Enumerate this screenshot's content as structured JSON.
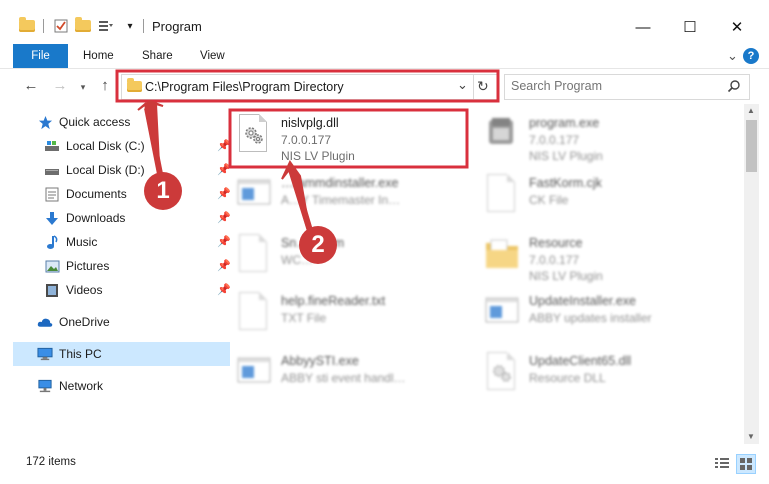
{
  "window": {
    "title": "Program",
    "min_glyph": "—",
    "max_glyph": "☐",
    "close_glyph": "✕"
  },
  "ribbon": {
    "tabs": [
      "File",
      "Home",
      "Share",
      "View"
    ],
    "expand_glyph": "⌄",
    "help_glyph": "?"
  },
  "address": {
    "path": "C:\\Program Files\\Program Directory",
    "dropdown_glyph": "⌄",
    "refresh_glyph": "↻"
  },
  "search": {
    "placeholder": "Search Program"
  },
  "sidebar": {
    "items": [
      {
        "label": "Quick access",
        "icon": "star-icon"
      },
      {
        "label": "Local Disk (C:)",
        "icon": "drive-icon",
        "pinned": true
      },
      {
        "label": "Local Disk (D:)",
        "icon": "drive-icon",
        "pinned": true
      },
      {
        "label": "Documents",
        "icon": "documents-icon",
        "pinned": true
      },
      {
        "label": "Downloads",
        "icon": "download-icon",
        "pinned": true
      },
      {
        "label": "Music",
        "icon": "music-icon",
        "pinned": true
      },
      {
        "label": "Pictures",
        "icon": "pictures-icon",
        "pinned": true
      },
      {
        "label": "Videos",
        "icon": "videos-icon",
        "pinned": true
      },
      {
        "label": "OneDrive",
        "icon": "cloud-icon"
      },
      {
        "label": "This PC",
        "icon": "computer-icon",
        "selected": true
      },
      {
        "label": "Network",
        "icon": "network-icon"
      }
    ]
  },
  "files": [
    {
      "name": "nislvplg.dll",
      "line2": "7.0.0.177",
      "line3": "NIS LV Plugin",
      "icon": "dll-gear-icon",
      "highlighted": true
    },
    {
      "name": "program.exe",
      "line2": "7.0.0.177",
      "line3": "NIS LV Plugin",
      "icon": "exe-icon"
    },
    {
      "name": "…rammdinstaller.exe",
      "line2": "A…Y Timemaster In…",
      "icon": "installer-icon"
    },
    {
      "name": "FastKorm.cjk",
      "line2": "CK File",
      "icon": "blank-doc-icon"
    },
    {
      "name": "Sn…k.wcm",
      "line2": "WC…",
      "icon": "blank-doc-icon"
    },
    {
      "name": "Resource",
      "line2": "7.0.0.177",
      "line3": "NIS LV Plugin",
      "icon": "folder-icon"
    },
    {
      "name": "help.fineReader.txt",
      "line2": "TXT File",
      "icon": "blank-doc-icon"
    },
    {
      "name": "UpdateInstaller.exe",
      "line2": "ABBY updates installer",
      "icon": "installer-icon"
    },
    {
      "name": "AbbyySTI.exe",
      "line2": "ABBY sti event handl…",
      "icon": "installer-icon"
    },
    {
      "name": "UpdateClient65.dll",
      "line2": "Resource DLL",
      "icon": "dll-gear-icon"
    }
  ],
  "annotations": [
    {
      "number": "1"
    },
    {
      "number": "2"
    }
  ],
  "status": {
    "count": "172 items"
  },
  "colors": {
    "accent": "#1979ca",
    "highlight_box": "#d9303d",
    "badge": "#cc3a3a",
    "selected_nav": "#cce8ff"
  }
}
